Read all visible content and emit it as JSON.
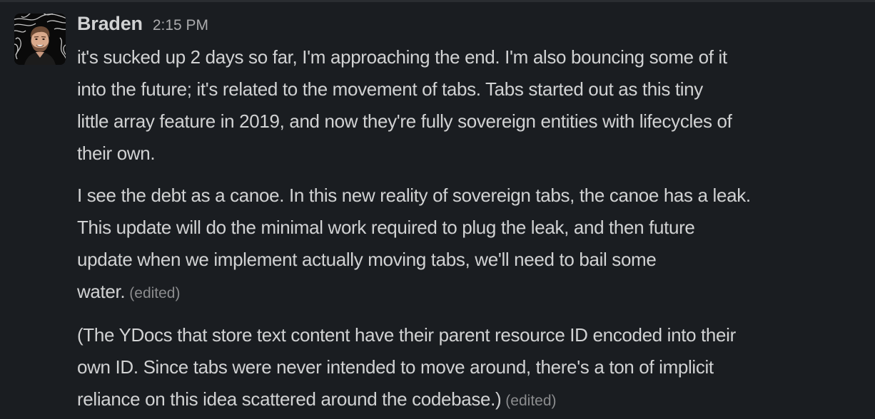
{
  "message": {
    "author": "Braden",
    "timestamp": "2:15 PM",
    "avatar_icon": "profile-photo",
    "paragraphs": [
      {
        "lines": [
          "it's sucked up 2 days so far, I'm approaching the end. I'm also bouncing some of it",
          "into the future; it's related to the movement of tabs. Tabs started out as this tiny",
          "little array feature in 2019, and now they're fully sovereign entities with lifecycles of",
          "their own."
        ],
        "edited": ""
      },
      {
        "lines": [
          "I see the debt as a canoe. In this new reality of sovereign tabs, the canoe has a leak.",
          "This update will do the minimal work required to plug the leak, and then future",
          "update when we implement actually moving tabs, we'll need to bail some",
          "water."
        ],
        "edited": "(edited)"
      },
      {
        "lines": [
          "(The YDocs that store text content have their parent resource ID encoded into their",
          "own ID. Since tabs were never intended to move around, there's a ton of implicit",
          "reliance on this idea scattered around the codebase.)"
        ],
        "edited": "(edited)"
      }
    ]
  },
  "colors": {
    "background": "#1a1d21",
    "text": "#d1d2d3",
    "muted": "#ababad",
    "edited": "#8b8c8e"
  }
}
